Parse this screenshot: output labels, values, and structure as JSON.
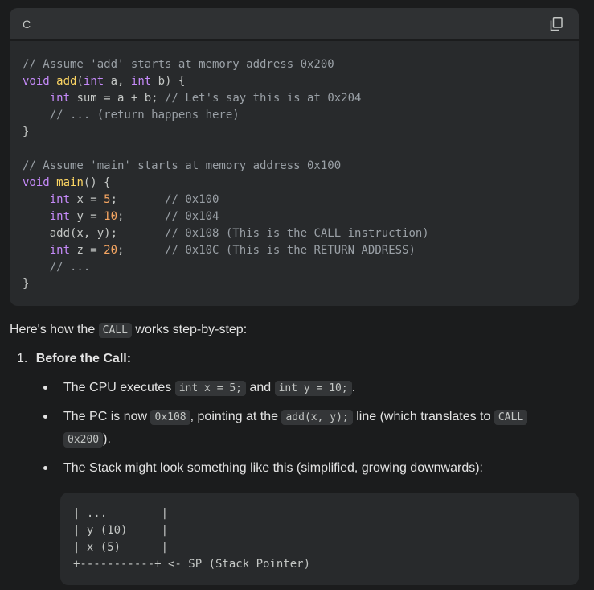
{
  "code_block": {
    "language": "C",
    "copy_icon": "copy-icon",
    "lines": [
      [
        {
          "t": "// Assume 'add' starts at memory address 0x200",
          "c": "cm"
        }
      ],
      [
        {
          "t": "void",
          "c": "kw"
        },
        {
          "t": " "
        },
        {
          "t": "add",
          "c": "fn"
        },
        {
          "t": "("
        },
        {
          "t": "int",
          "c": "kw"
        },
        {
          "t": " a, "
        },
        {
          "t": "int",
          "c": "kw"
        },
        {
          "t": " b) {"
        }
      ],
      [
        {
          "t": "    "
        },
        {
          "t": "int",
          "c": "kw"
        },
        {
          "t": " sum = a + b; "
        },
        {
          "t": "// Let's say this is at 0x204",
          "c": "cm"
        }
      ],
      [
        {
          "t": "    "
        },
        {
          "t": "// ... (return happens here)",
          "c": "cm"
        }
      ],
      [
        {
          "t": "}"
        }
      ],
      [
        {
          "t": ""
        }
      ],
      [
        {
          "t": "// Assume 'main' starts at memory address 0x100",
          "c": "cm"
        }
      ],
      [
        {
          "t": "void",
          "c": "kw"
        },
        {
          "t": " "
        },
        {
          "t": "main",
          "c": "fn"
        },
        {
          "t": "() {"
        }
      ],
      [
        {
          "t": "    "
        },
        {
          "t": "int",
          "c": "kw"
        },
        {
          "t": " x = "
        },
        {
          "t": "5",
          "c": "num"
        },
        {
          "t": ";       "
        },
        {
          "t": "// 0x100",
          "c": "cm"
        }
      ],
      [
        {
          "t": "    "
        },
        {
          "t": "int",
          "c": "kw"
        },
        {
          "t": " y = "
        },
        {
          "t": "10",
          "c": "num"
        },
        {
          "t": ";      "
        },
        {
          "t": "// 0x104",
          "c": "cm"
        }
      ],
      [
        {
          "t": "    add(x, y);       "
        },
        {
          "t": "// 0x108 (This is the CALL instruction)",
          "c": "cm"
        }
      ],
      [
        {
          "t": "    "
        },
        {
          "t": "int",
          "c": "kw"
        },
        {
          "t": " z = "
        },
        {
          "t": "20",
          "c": "num"
        },
        {
          "t": ";      "
        },
        {
          "t": "// 0x10C (This is the RETURN ADDRESS)",
          "c": "cm"
        }
      ],
      [
        {
          "t": "    "
        },
        {
          "t": "// ...",
          "c": "cm"
        }
      ],
      [
        {
          "t": "}"
        }
      ]
    ]
  },
  "intro": {
    "before": "Here's how the ",
    "code": "CALL",
    "after": " works step-by-step:"
  },
  "step1": {
    "number": "1.",
    "title": "Before the Call:"
  },
  "bullets": {
    "b1": {
      "before": "The CPU executes ",
      "code1": "int x = 5;",
      "mid": " and ",
      "code2": "int y = 10;",
      "after": "."
    },
    "b2": {
      "before": "The PC is now ",
      "code1": "0x108",
      "mid": ", pointing at the ",
      "code2": "add(x, y);",
      "after": " line (which translates to ",
      "code3a": "CALL",
      "code3b": "0x200",
      "end": ")."
    },
    "b3": {
      "text": "The Stack might look something like this (simplified, growing downwards):"
    }
  },
  "stack": {
    "lines": [
      "| ...        |",
      "| y (10)     |",
      "| x (5)      |",
      "+-----------+ <- SP (Stack Pointer)"
    ]
  }
}
